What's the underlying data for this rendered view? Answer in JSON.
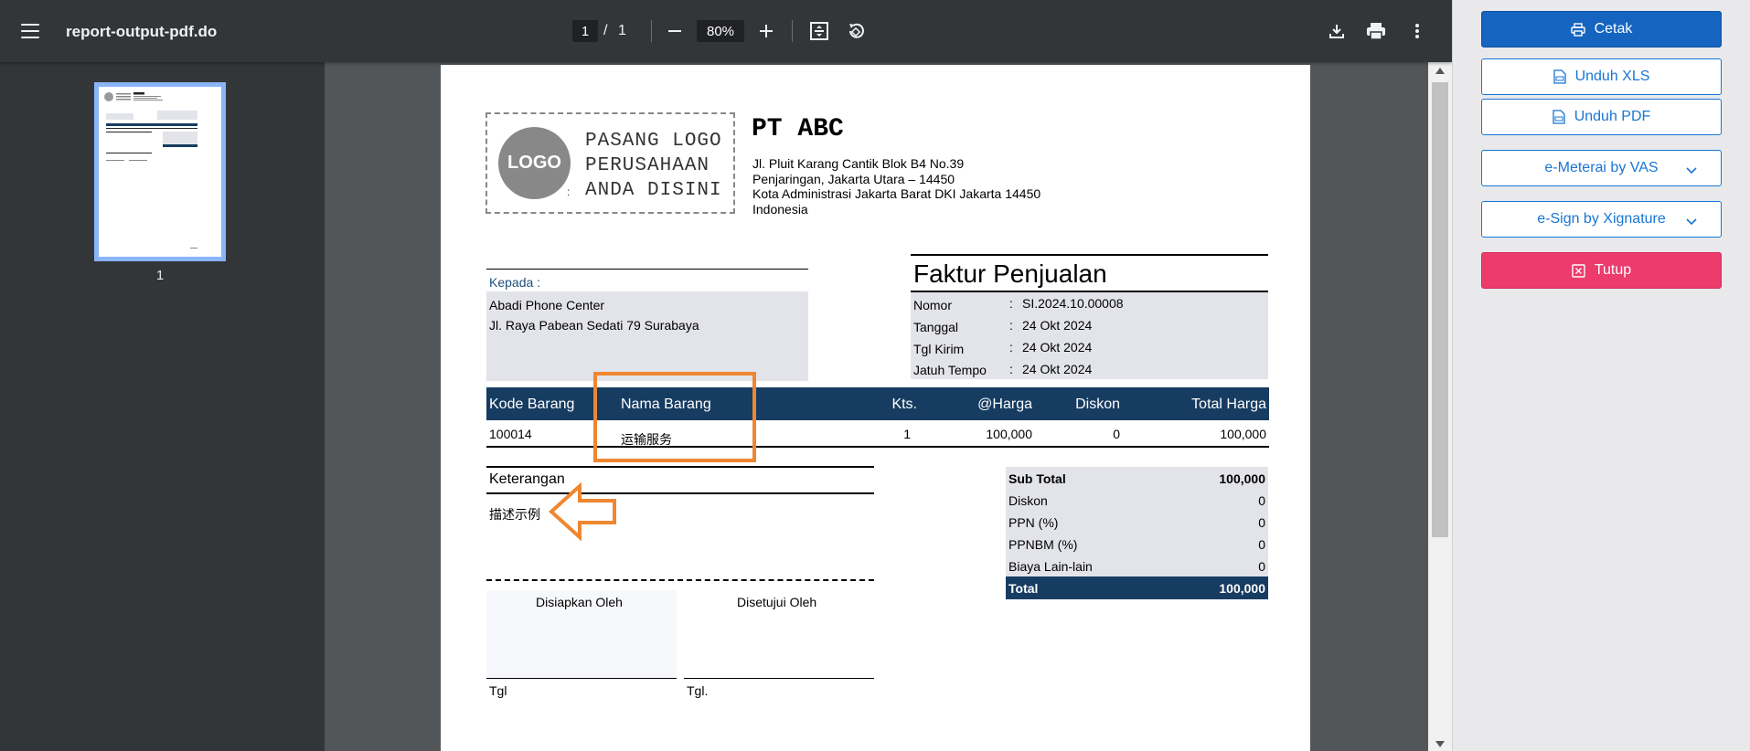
{
  "viewer": {
    "title": "report-output-pdf.do",
    "page_current": "1",
    "page_sep": "/",
    "page_total": "1",
    "zoom": "80%",
    "thumbnail_label": "1"
  },
  "document": {
    "logo": {
      "circle_text": "LOGO",
      "line1": "PASANG LOGO",
      "line2": "PERUSAHAAN",
      "line3": "ANDA DISINI",
      "colon": ":"
    },
    "company": {
      "name": "PT ABC",
      "address": [
        "Jl. Pluit Karang Cantik Blok B4 No.39",
        "Penjaringan, Jakarta Utara – 14450",
        "Kota Administrasi Jakarta Barat DKI Jakarta 14450",
        "Indonesia"
      ]
    },
    "recipient": {
      "label": "Kepada :",
      "name": "Abadi Phone Center",
      "address": "Jl. Raya Pabean Sedati 79 Surabaya"
    },
    "invoice": {
      "title": "Faktur Penjualan",
      "fields": [
        {
          "label": "Nomor",
          "colon": ":",
          "value": "SI.2024.10.00008"
        },
        {
          "label": "Tanggal",
          "colon": ":",
          "value": "24 Okt 2024"
        },
        {
          "label": "Tgl Kirim",
          "colon": ":",
          "value": "24 Okt 2024"
        },
        {
          "label": "Jatuh Tempo",
          "colon": ":",
          "value": "24 Okt 2024"
        }
      ]
    },
    "items": {
      "headers": {
        "code": "Kode Barang",
        "name": "Nama Barang",
        "qty": "Kts.",
        "price": "@Harga",
        "discount": "Diskon",
        "total": "Total Harga"
      },
      "rows": [
        {
          "code": "100014",
          "name": "运输服务",
          "qty": "1",
          "price": "100,000",
          "discount": "0",
          "total": "100,000"
        }
      ]
    },
    "notes": {
      "title": "Keterangan",
      "text": "描述示例"
    },
    "signatures": {
      "prepared": "Disiapkan Oleh",
      "approved": "Disetujui Oleh",
      "date_left": "Tgl",
      "date_right": "Tgl."
    },
    "totals": [
      {
        "label": "Sub Total",
        "value": "100,000"
      },
      {
        "label": "Diskon",
        "value": "0"
      },
      {
        "label": "PPN (%)",
        "value": "0"
      },
      {
        "label": "PPNBM (%)",
        "value": "0"
      },
      {
        "label": "Biaya Lain-lain",
        "value": "0"
      },
      {
        "label": "Total",
        "value": "100,000"
      }
    ]
  },
  "sidebar": {
    "print": "Cetak",
    "download_xls": "Unduh XLS",
    "download_pdf": "Unduh PDF",
    "emeterai": "e-Meterai by VAS",
    "esign": "e-Sign by Xignature",
    "close": "Tutup"
  },
  "colors": {
    "table_header": "#173c61",
    "primary": "#1565c0",
    "danger": "#ec3b6c",
    "annotation": "#ef8731"
  }
}
